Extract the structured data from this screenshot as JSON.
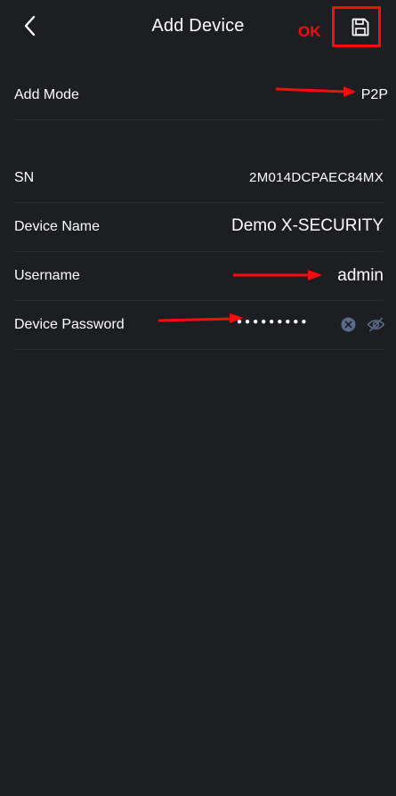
{
  "header": {
    "title": "Add Device",
    "ok_annotation": "OK",
    "back_icon": "chevron-left-icon",
    "save_icon": "floppy-disk-icon"
  },
  "add_mode": {
    "label": "Add Mode",
    "value": "P2P"
  },
  "sn": {
    "label": "SN",
    "value": "2M014DCPAEC84MX"
  },
  "device_name": {
    "label": "Device Name",
    "value": "Demo X-SECURITY"
  },
  "username": {
    "label": "Username",
    "value": "admin"
  },
  "password": {
    "label": "Device Password",
    "masked_value": "●●●●●●●●●",
    "clear_icon": "clear-circle-icon",
    "visibility_icon": "eye-hidden-icon"
  },
  "colors": {
    "background": "#1c1e22",
    "annotation_red": "#ff0a0a",
    "divider": "#2c2f35",
    "icon_accent": "#5b6b8c"
  }
}
